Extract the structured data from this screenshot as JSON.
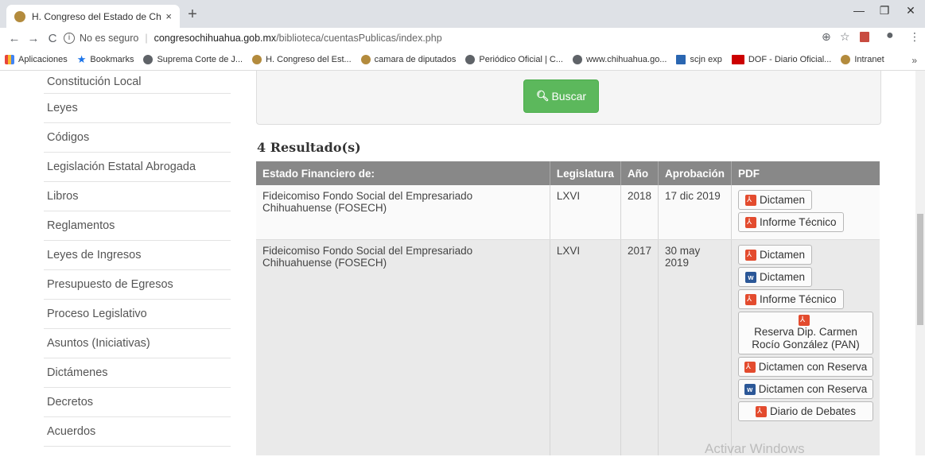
{
  "browser": {
    "tab_title": "H. Congreso del Estado de Chihu",
    "tab_close": "×",
    "new_tab": "+",
    "security": "No es seguro",
    "url_host": "congresochihuahua.gob.mx",
    "url_path": "/biblioteca/cuentasPublicas/index.php",
    "bookmarks": [
      {
        "label": "Aplicaciones",
        "icon": "apps-icon"
      },
      {
        "label": "Bookmarks",
        "icon": "star-icon"
      },
      {
        "label": "Suprema Corte de J...",
        "icon": "globe-icon"
      },
      {
        "label": "H. Congreso del Est...",
        "icon": "seal-icon"
      },
      {
        "label": "camara de diputados",
        "icon": "seal-icon"
      },
      {
        "label": "Periódico Oficial | C...",
        "icon": "globe-icon"
      },
      {
        "label": "www.chihuahua.go...",
        "icon": "globe-icon"
      },
      {
        "label": "scjn exp",
        "icon": "bird-icon"
      },
      {
        "label": "DOF - Diario Oficial...",
        "icon": "dof-icon"
      },
      {
        "label": "Intranet",
        "icon": "seal-icon"
      }
    ],
    "more_bookmarks": "»"
  },
  "sidebar": {
    "items": [
      "Constitución Local",
      "Leyes",
      "Códigos",
      "Legislación Estatal Abrogada",
      "Libros",
      "Reglamentos",
      "Leyes de Ingresos",
      "Presupuesto de Egresos",
      "Proceso Legislativo",
      "Asuntos (Iniciativas)",
      "Dictámenes",
      "Decretos",
      "Acuerdos"
    ]
  },
  "search": {
    "button_label": "Buscar"
  },
  "results": {
    "title": "4 Resultado(s)",
    "headers": [
      "Estado Financiero de:",
      "Legislatura",
      "Año",
      "Aprobación",
      "PDF"
    ],
    "rows": [
      {
        "entity": "Fideicomiso Fondo Social del Empresariado Chihuahuense (FOSECH)",
        "legislatura": "LXVI",
        "anio": "2018",
        "aprobacion": "17 dic 2019",
        "docs": [
          {
            "label": "Dictamen",
            "type": "pdf"
          },
          {
            "label": "Informe Técnico",
            "type": "pdf"
          }
        ]
      },
      {
        "entity": "Fideicomiso Fondo Social del Empresariado Chihuahuense (FOSECH)",
        "legislatura": "LXVI",
        "anio": "2017",
        "aprobacion": "30 may 2019",
        "docs": [
          {
            "label": "Dictamen",
            "type": "pdf"
          },
          {
            "label": "Dictamen",
            "type": "word"
          },
          {
            "label": "Informe Técnico",
            "type": "pdf"
          },
          {
            "label": "Reserva Dip. Carmen Rocío González (PAN)",
            "type": "pdf"
          },
          {
            "label": "Dictamen con Reserva",
            "type": "pdf"
          },
          {
            "label": "Dictamen con Reserva",
            "type": "word"
          },
          {
            "label": "Diario de Debates",
            "type": "pdf"
          }
        ]
      }
    ]
  },
  "watermark": "Activar Windows",
  "colors": {
    "accent_green": "#5cb85c",
    "table_header": "#888888",
    "pdf_red": "#e34b2e",
    "word_blue": "#2b5797"
  }
}
